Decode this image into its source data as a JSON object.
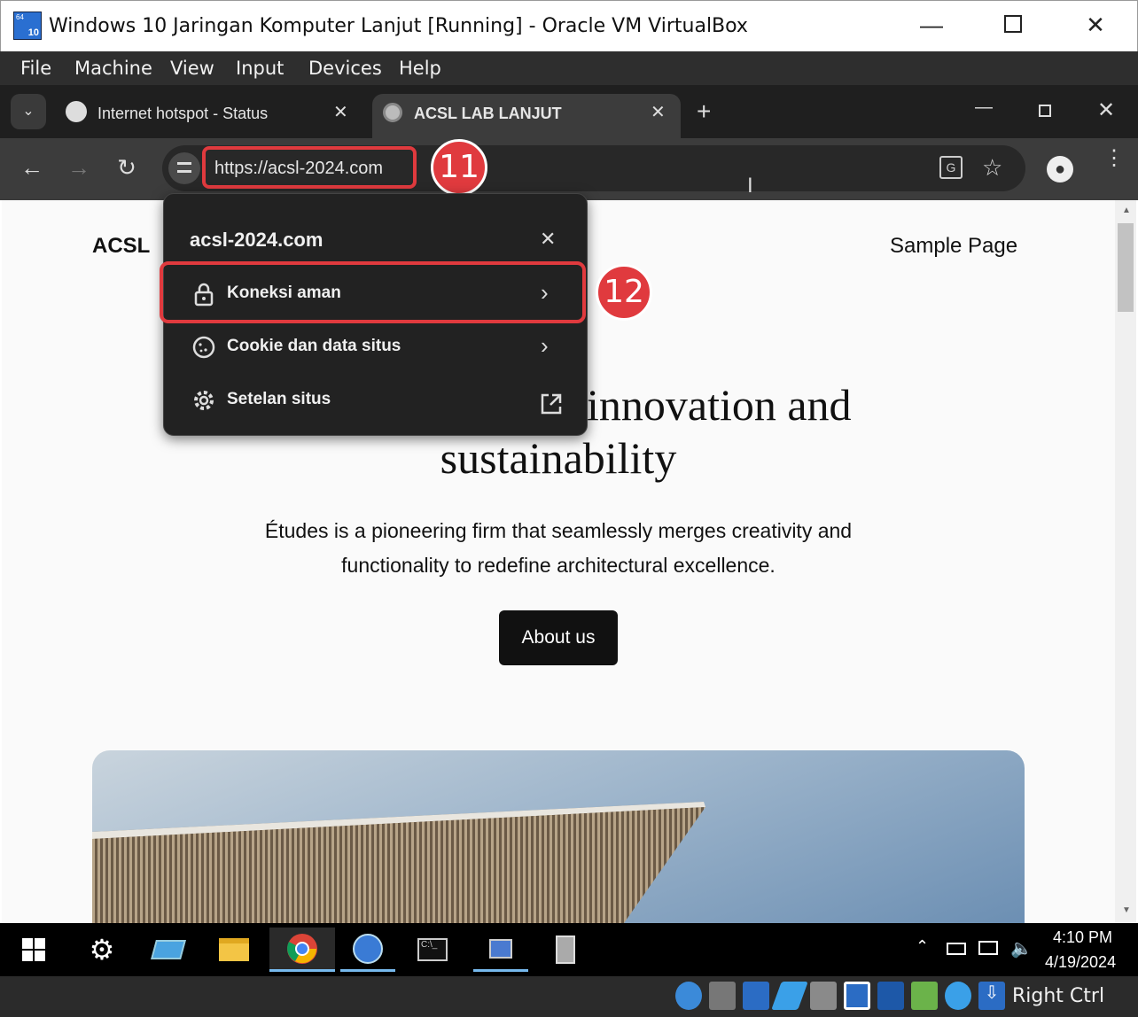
{
  "vbox": {
    "title": "Windows 10 Jaringan Komputer Lanjut [Running] - Oracle VM VirtualBox",
    "menu": [
      "File",
      "Machine",
      "View",
      "Input",
      "Devices",
      "Help"
    ],
    "host_key": "Right Ctrl"
  },
  "browser": {
    "tabs": [
      {
        "label": "Internet hotspot - Status",
        "active": false
      },
      {
        "label": "ACSL LAB LANJUT",
        "active": true
      }
    ],
    "url": "https://acsl-2024.com"
  },
  "popup": {
    "domain": "acsl-2024.com",
    "items": [
      {
        "label": "Koneksi aman",
        "icon": "lock-icon"
      },
      {
        "label": "Cookie dan data situs",
        "icon": "cookie-icon"
      },
      {
        "label": "Setelan situs",
        "icon": "gear-icon"
      }
    ]
  },
  "annotations": {
    "step1": "11",
    "step2": "12"
  },
  "site": {
    "brand": "ACSL",
    "nav_link": "Sample Page",
    "heading_line1": "innovation and",
    "heading_line2": "sustainability",
    "paragraph_line1": "Études is a pioneering firm that seamlessly merges creativity and",
    "paragraph_line2": "functionality to redefine architectural excellence.",
    "cta": "About us"
  },
  "taskbar": {
    "time": "4:10 PM",
    "date": "4/19/2024"
  },
  "colors": {
    "annotation_red": "#e03a3e",
    "chrome_dark": "#1f1f1f",
    "popup_bg": "#222222"
  }
}
